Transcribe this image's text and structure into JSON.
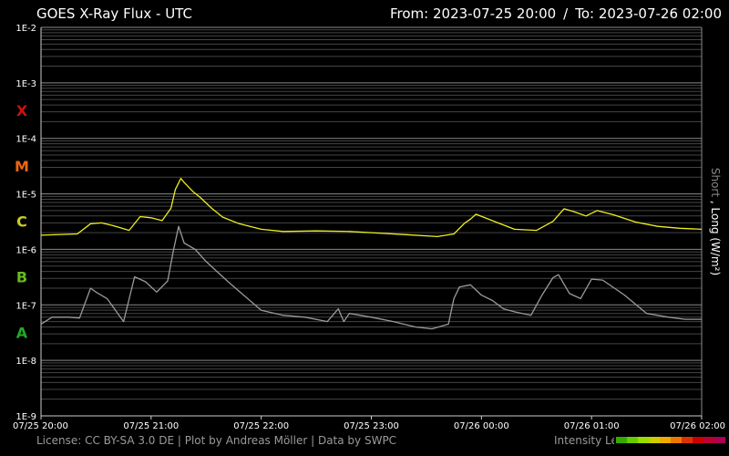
{
  "header": {
    "title": "GOES X-Ray Flux - UTC",
    "from_label": "From: 2023-07-25 20:00",
    "to_label": "To: 2023-07-26 02:00",
    "separator": "/"
  },
  "footer": {
    "license": "License: CC BY-SA 3.0 DE | Plot by Andreas Möller | Data by SWPC",
    "legend_label": "Intensity Legend",
    "legend_colors": [
      "#33aa00",
      "#66cc00",
      "#99dd00",
      "#cccc00",
      "#eeaa00",
      "#ee7700",
      "#dd3300",
      "#cc0000",
      "#bb0033",
      "#aa0055"
    ]
  },
  "chart_data": {
    "type": "line",
    "log_scale": true,
    "y_label_short": "Short",
    "y_label_long": "Long (W/m²)",
    "y_label_sep": ",",
    "y_ticks": [
      "1E-2",
      "1E-3",
      "1E-4",
      "1E-5",
      "1E-6",
      "1E-7",
      "1E-8",
      "1E-9"
    ],
    "ylim": [
      1e-09,
      0.01
    ],
    "x_ticks": [
      "07/25 20:00",
      "07/25 21:00",
      "07/25 22:00",
      "07/25 23:00",
      "07/26 00:00",
      "07/26 01:00",
      "07/26 02:00"
    ],
    "x_tick_hours": [
      0,
      1,
      2,
      3,
      4,
      5,
      6
    ],
    "x_range_hours": [
      0,
      6
    ],
    "classes": [
      {
        "label": "X",
        "color": "#cc1111",
        "flux": 0.00032
      },
      {
        "label": "M",
        "color": "#ee6611",
        "flux": 3.2e-05
      },
      {
        "label": "C",
        "color": "#cccc22",
        "flux": 3.2e-06
      },
      {
        "label": "B",
        "color": "#66bb22",
        "flux": 3.2e-07
      },
      {
        "label": "A",
        "color": "#22aa22",
        "flux": 3.2e-08
      }
    ],
    "grid": true,
    "series": [
      {
        "name": "Long",
        "color": "#eeee22",
        "x": [
          0,
          0.33,
          0.45,
          0.55,
          0.65,
          0.8,
          0.9,
          1.0,
          1.1,
          1.18,
          1.22,
          1.27,
          1.3,
          1.38,
          1.45,
          1.55,
          1.65,
          1.8,
          2.0,
          2.2,
          2.5,
          2.8,
          3.0,
          3.3,
          3.6,
          3.75,
          3.85,
          3.9,
          3.95,
          4.05,
          4.15,
          4.3,
          4.5,
          4.65,
          4.75,
          4.85,
          4.95,
          5.05,
          5.2,
          5.4,
          5.6,
          5.8,
          6.0
        ],
        "values": [
          1.8e-06,
          1.9e-06,
          2.9e-06,
          3e-06,
          2.7e-06,
          2.2e-06,
          3.9e-06,
          3.7e-06,
          3.3e-06,
          5.5e-06,
          1.2e-05,
          1.9e-05,
          1.6e-05,
          1.1e-05,
          8.5e-06,
          5.5e-06,
          3.8e-06,
          2.9e-06,
          2.3e-06,
          2.1e-06,
          2.15e-06,
          2.1e-06,
          2e-06,
          1.85e-06,
          1.7e-06,
          1.9e-06,
          3e-06,
          3.5e-06,
          4.3e-06,
          3.6e-06,
          3e-06,
          2.3e-06,
          2.2e-06,
          3.2e-06,
          5.4e-06,
          4.7e-06,
          4e-06,
          5e-06,
          4.2e-06,
          3.1e-06,
          2.6e-06,
          2.4e-06,
          2.3e-06
        ]
      },
      {
        "name": "Short",
        "color": "#9a9a9a",
        "x": [
          0,
          0.1,
          0.25,
          0.35,
          0.45,
          0.5,
          0.6,
          0.75,
          0.85,
          0.95,
          1.05,
          1.15,
          1.2,
          1.25,
          1.3,
          1.4,
          1.5,
          1.7,
          2.0,
          2.2,
          2.4,
          2.6,
          2.7,
          2.75,
          2.8,
          3.0,
          3.2,
          3.4,
          3.55,
          3.7,
          3.75,
          3.8,
          3.9,
          4.0,
          4.1,
          4.2,
          4.3,
          4.45,
          4.55,
          4.65,
          4.7,
          4.8,
          4.9,
          5.0,
          5.1,
          5.3,
          5.5,
          5.7,
          5.85,
          6.0
        ],
        "values": [
          4.5e-08,
          6e-08,
          6e-08,
          5.8e-08,
          2e-07,
          1.7e-07,
          1.3e-07,
          5e-08,
          3.2e-07,
          2.6e-07,
          1.7e-07,
          2.7e-07,
          9e-07,
          2.6e-06,
          1.3e-06,
          1e-06,
          6e-07,
          2.6e-07,
          8e-08,
          6.5e-08,
          6e-08,
          5e-08,
          8.5e-08,
          5e-08,
          7e-08,
          6e-08,
          5e-08,
          4e-08,
          3.7e-08,
          4.5e-08,
          1.3e-07,
          2.1e-07,
          2.3e-07,
          1.5e-07,
          1.2e-07,
          8.5e-08,
          7.5e-08,
          6.5e-08,
          1.5e-07,
          3.1e-07,
          3.5e-07,
          1.6e-07,
          1.3e-07,
          2.9e-07,
          2.8e-07,
          1.5e-07,
          7e-08,
          6e-08,
          5.5e-08,
          5.5e-08
        ]
      }
    ]
  }
}
